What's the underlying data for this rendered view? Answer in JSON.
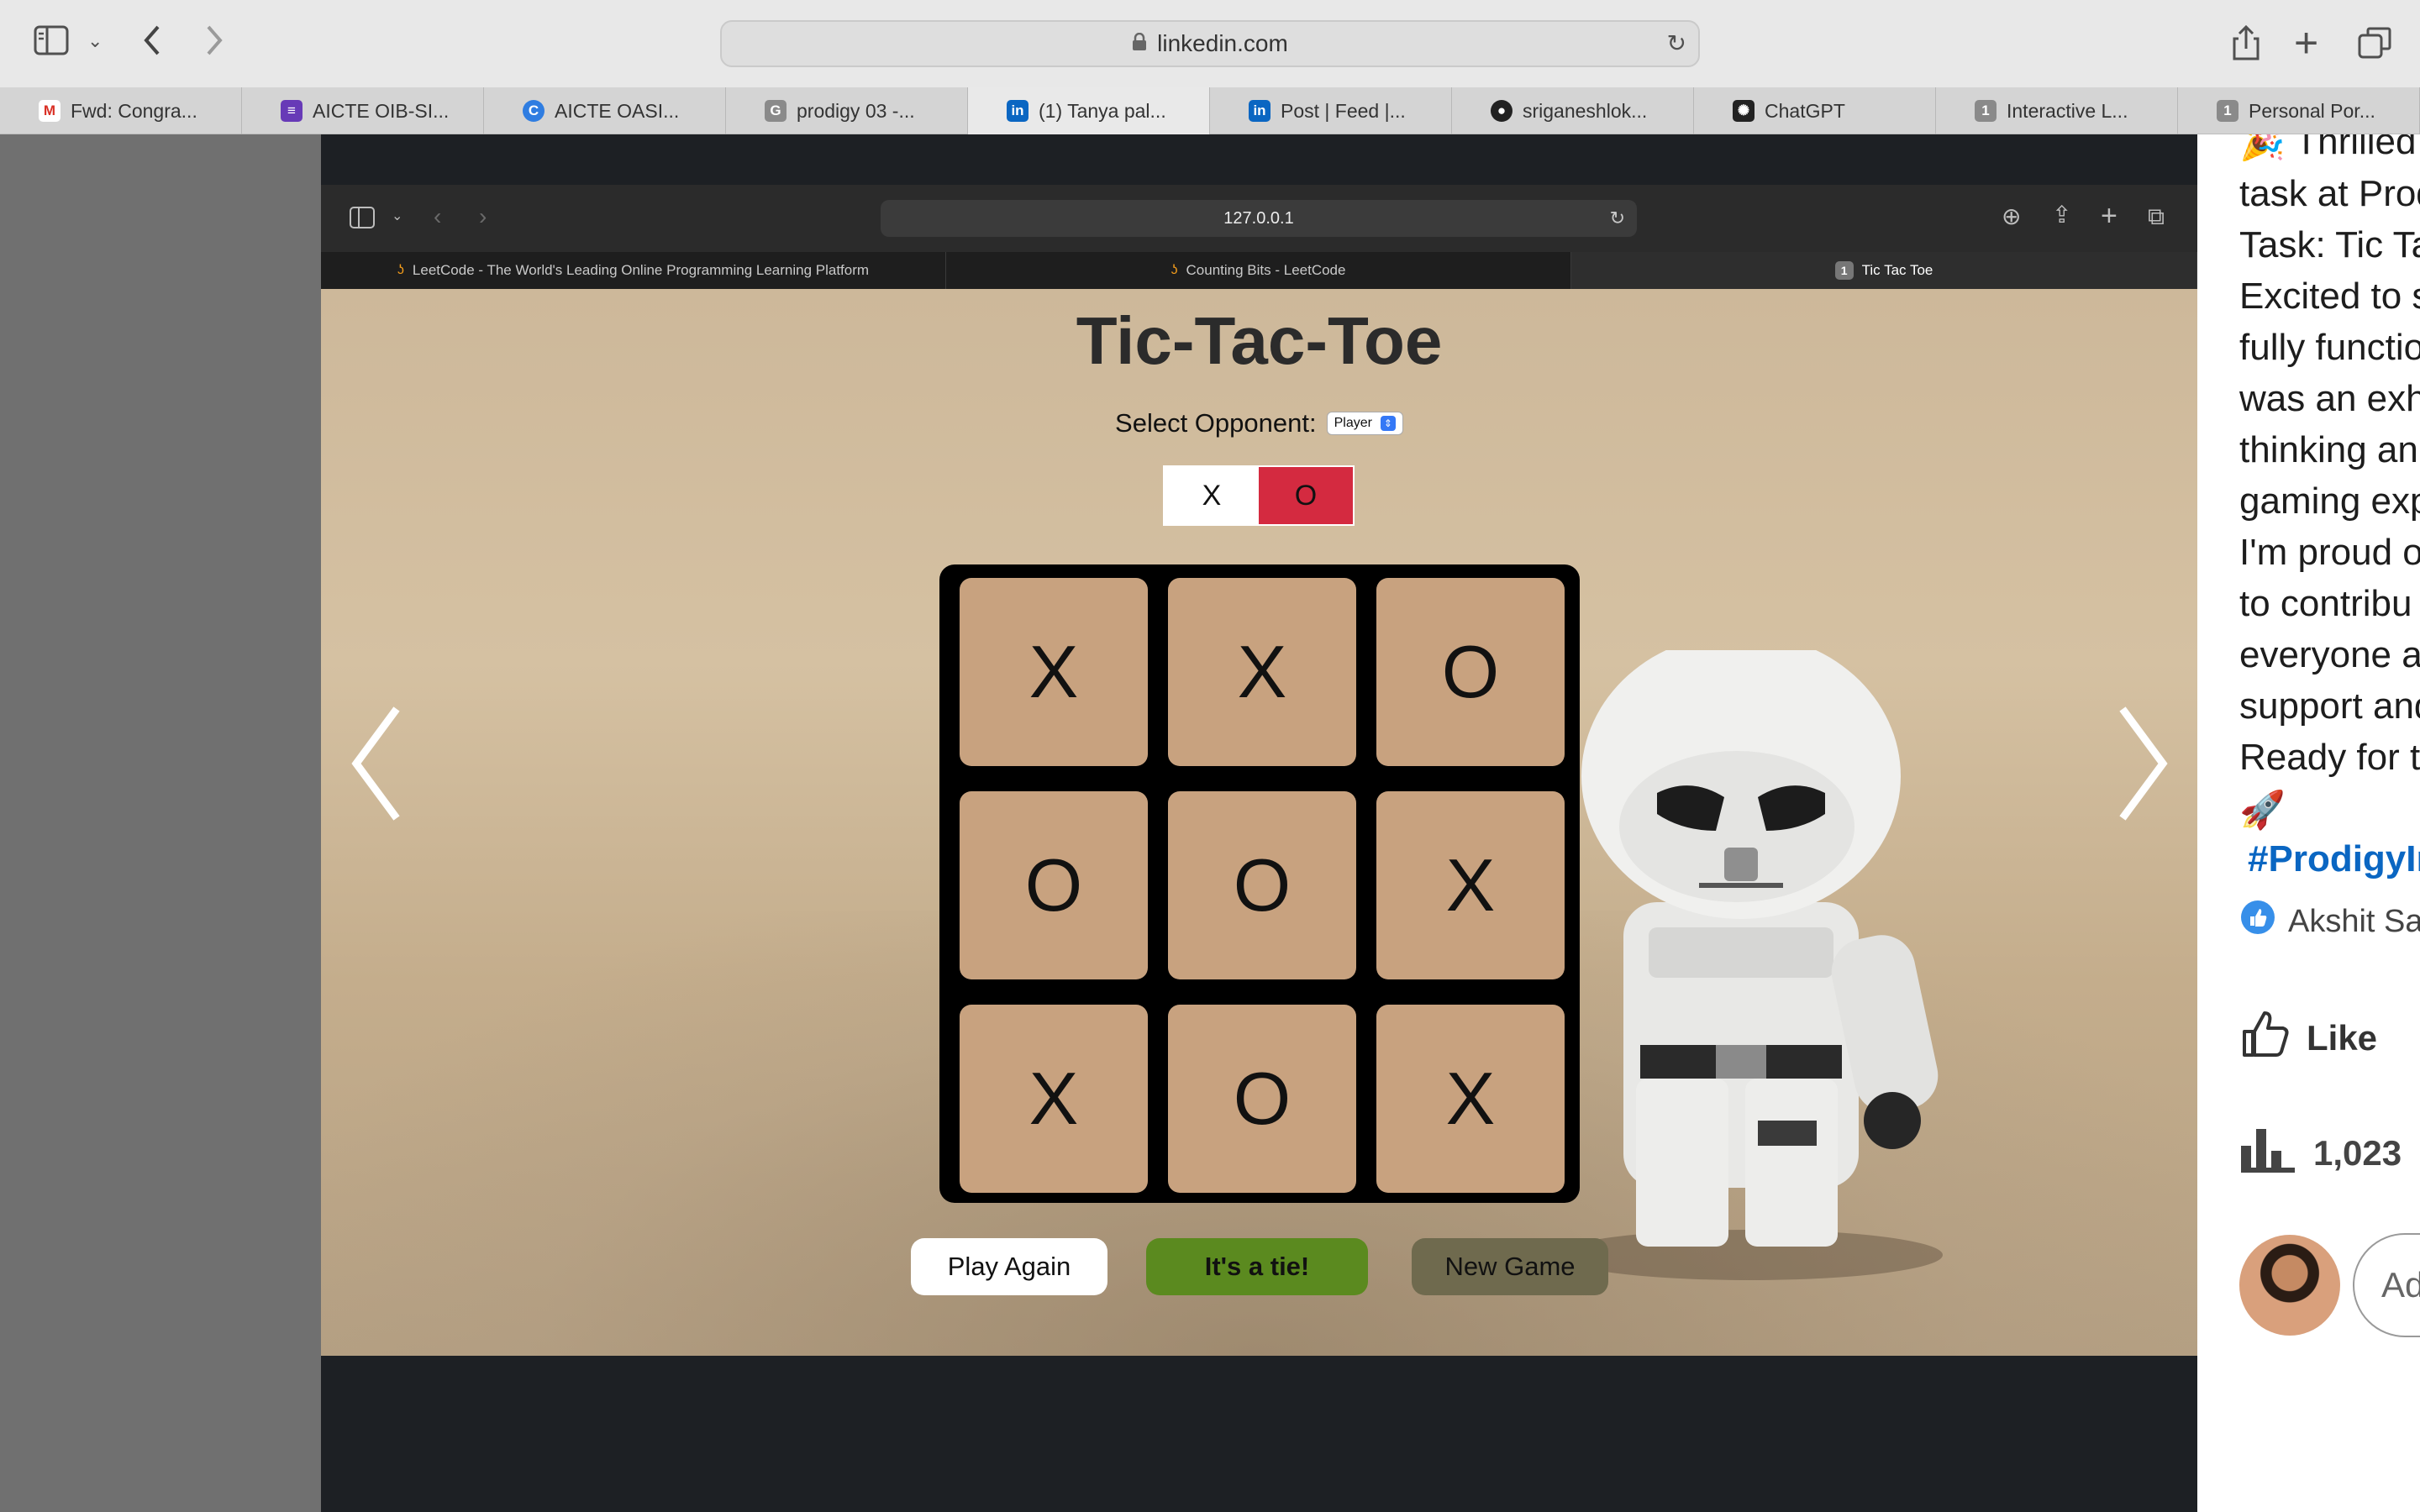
{
  "browser": {
    "url": "linkedin.com",
    "tabs": [
      {
        "label": "Fwd: Congra...",
        "icon": "gmail-icon",
        "color": "#d93025",
        "glyph": "M"
      },
      {
        "label": "AICTE OIB-SI...",
        "icon": "forms-icon",
        "color": "#673ab7",
        "glyph": "≡"
      },
      {
        "label": "AICTE OASI...",
        "icon": "c-logo-icon",
        "color": "#2f7de1",
        "glyph": "C"
      },
      {
        "label": "prodigy 03 -...",
        "icon": "g-letter-icon",
        "color": "#8a8a8a",
        "glyph": "G"
      },
      {
        "label": "(1) Tanya pal...",
        "icon": "linkedin-icon",
        "color": "#0a66c2",
        "glyph": "in"
      },
      {
        "label": "Post | Feed |...",
        "icon": "linkedin-icon",
        "color": "#0a66c2",
        "glyph": "in"
      },
      {
        "label": "sriganeshlok...",
        "icon": "github-icon",
        "color": "#222222",
        "glyph": "●"
      },
      {
        "label": "ChatGPT",
        "icon": "chatgpt-icon",
        "color": "#222222",
        "glyph": "✺"
      },
      {
        "label": "Interactive L...",
        "icon": "number-1-icon",
        "color": "#8a8a8a",
        "glyph": "1"
      },
      {
        "label": "Personal Por...",
        "icon": "number-1-icon",
        "color": "#8a8a8a",
        "glyph": "1"
      }
    ]
  },
  "inner_browser": {
    "url": "127.0.0.1",
    "tabs": [
      {
        "label": "LeetCode - The World's Leading Online Programming Learning Platform"
      },
      {
        "label": "Counting Bits - LeetCode"
      },
      {
        "label": "Tic Tac Toe",
        "badge": "1"
      }
    ]
  },
  "game": {
    "title": "Tic-Tac-Toe",
    "opponent_label": "Select Opponent:",
    "opponent_value": "Player",
    "turn_x": "X",
    "turn_o": "O",
    "board": [
      "X",
      "X",
      "O",
      "O",
      "O",
      "X",
      "X",
      "O",
      "X"
    ],
    "play_again": "Play Again",
    "status": "It's a tie!",
    "new_game": "New Game",
    "colors": {
      "cell": "#c8a27f",
      "active_turn": "#d42a40",
      "status_button": "#5b8a1f",
      "new_game_button": "#6f6a4e"
    }
  },
  "linkedin_post": {
    "lines": [
      "🎉 Thrilled",
      "task at Prod",
      "Task: Tic Ta",
      "Excited to s",
      "fully functio",
      "was an exh",
      "thinking an",
      "gaming exp",
      "I'm proud o",
      "to contribu",
      "everyone a",
      "support and",
      "Ready for t",
      "🚀"
    ],
    "hashtag": "#ProdigyIn",
    "reaction_name": "Akshit Sa",
    "like_label": "Like",
    "views": "1,023",
    "comment_placeholder": "Ad"
  }
}
